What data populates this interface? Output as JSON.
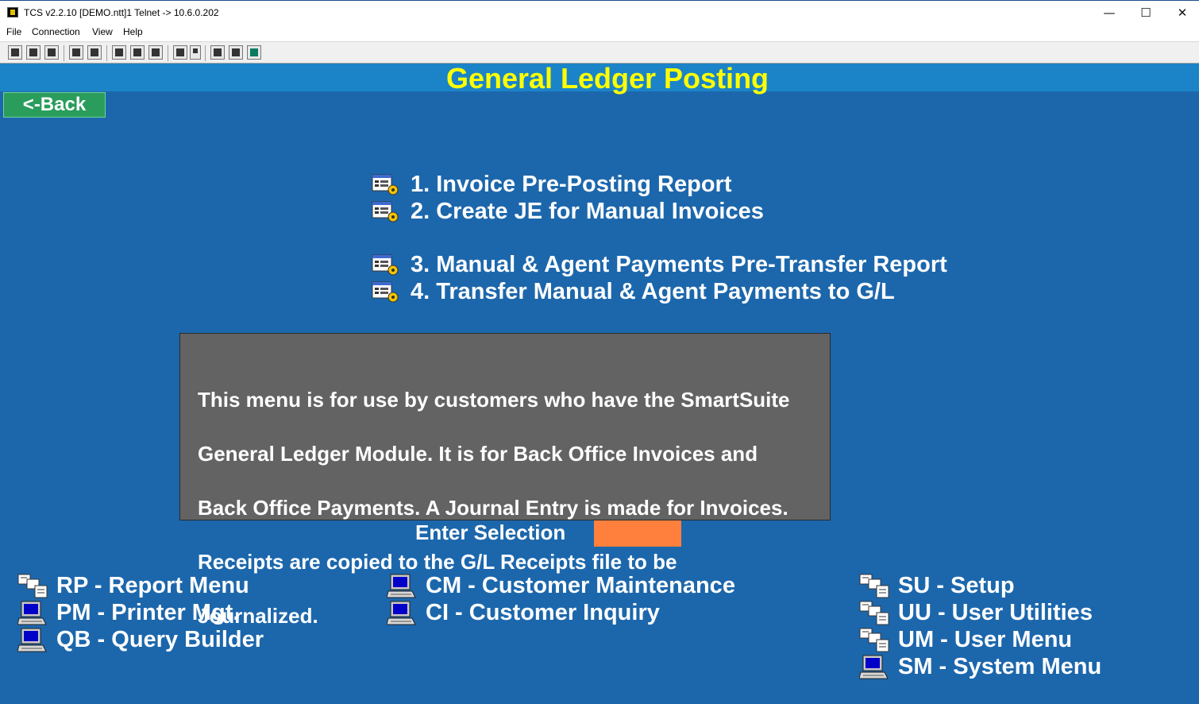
{
  "window": {
    "title": "TCS v2.2.10 [DEMO.ntt]1 Telnet -> 10.6.0.202",
    "minimize": "—",
    "maximize": "☐",
    "close": "✕"
  },
  "menubar": [
    "File",
    "Connection",
    "View",
    "Help"
  ],
  "screen": {
    "title": "General Ledger Posting",
    "back_label": "<-Back",
    "options": [
      {
        "label": "1. Invoice Pre-Posting Report",
        "icon": "report-gear-icon"
      },
      {
        "label": "2. Create JE for Manual Invoices",
        "icon": "report-gear-icon"
      },
      {
        "label": "3. Manual & Agent Payments Pre-Transfer Report",
        "icon": "report-gear-icon"
      },
      {
        "label": "4. Transfer Manual & Agent Payments to G/L",
        "icon": "report-gear-icon"
      }
    ],
    "info_lines": [
      "This menu is for use by customers who have the SmartSuite",
      "General Ledger Module.  It is for Back Office Invoices and",
      "Back Office Payments. A Journal Entry is made for Invoices.",
      "Receipts are copied to the G/L Receipts file to be",
      "Journalized."
    ],
    "enter_selection_label": "Enter Selection",
    "enter_selection_value": "",
    "nav_left": [
      {
        "label": "RP - Report Menu",
        "icon": "menu-icon"
      },
      {
        "label": "PM - Printer Mgt.",
        "icon": "computer-icon"
      },
      {
        "label": "QB - Query Builder",
        "icon": "computer-icon"
      }
    ],
    "nav_middle": [
      {
        "label": "CM - Customer Maintenance",
        "icon": "computer-icon"
      },
      {
        "label": "CI - Customer Inquiry",
        "icon": "computer-icon"
      }
    ],
    "nav_right": [
      {
        "label": "SU - Setup",
        "icon": "menu-icon"
      },
      {
        "label": "UU - User Utilities",
        "icon": "menu-icon"
      },
      {
        "label": "UM - User Menu",
        "icon": "menu-icon"
      },
      {
        "label": "SM - System Menu",
        "icon": "computer-icon"
      }
    ]
  },
  "colors": {
    "screen_bg": "#1c67ac",
    "header_band": "#1b84c8",
    "title": "#ffff00",
    "back_button": "#2a9d5c",
    "info_box": "#636363",
    "input_bg": "#ff7f3d"
  }
}
